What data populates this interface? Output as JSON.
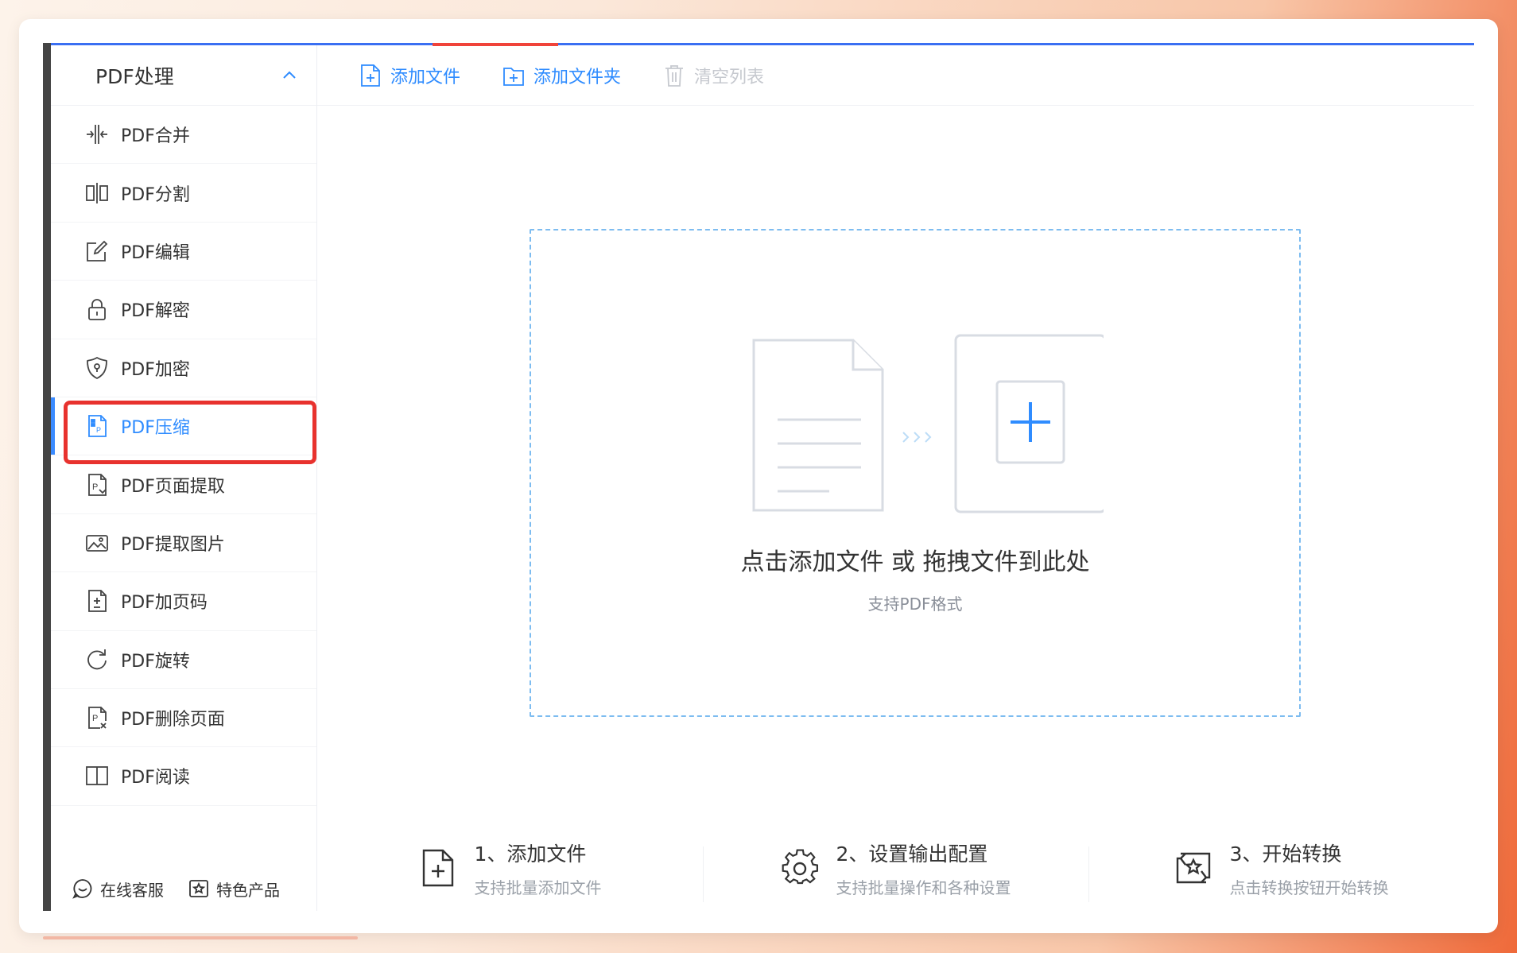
{
  "sidebar": {
    "header_title": "PDF处理",
    "items": [
      {
        "label": "PDF合并",
        "icon": "merge-icon"
      },
      {
        "label": "PDF分割",
        "icon": "split-icon"
      },
      {
        "label": "PDF编辑",
        "icon": "edit-icon"
      },
      {
        "label": "PDF解密",
        "icon": "unlock-icon"
      },
      {
        "label": "PDF加密",
        "icon": "shield-lock-icon"
      },
      {
        "label": "PDF压缩",
        "icon": "compress-icon",
        "active": true
      },
      {
        "label": "PDF页面提取",
        "icon": "page-extract-icon"
      },
      {
        "label": "PDF提取图片",
        "icon": "image-extract-icon"
      },
      {
        "label": "PDF加页码",
        "icon": "page-number-icon"
      },
      {
        "label": "PDF旋转",
        "icon": "rotate-icon"
      },
      {
        "label": "PDF删除页面",
        "icon": "delete-page-icon"
      },
      {
        "label": "PDF阅读",
        "icon": "book-icon"
      }
    ],
    "footer": {
      "support_label": "在线客服",
      "featured_label": "特色产品"
    }
  },
  "toolbar": {
    "add_file_label": "添加文件",
    "add_folder_label": "添加文件夹",
    "clear_list_label": "清空列表"
  },
  "dropzone": {
    "main_text": "点击添加文件 或 拖拽文件到此处",
    "sub_text": "支持PDF格式"
  },
  "steps": [
    {
      "title": "1、添加文件",
      "desc": "支持批量添加文件",
      "icon": "add-file-icon"
    },
    {
      "title": "2、设置输出配置",
      "desc": "支持批量操作和各种设置",
      "icon": "gear-icon"
    },
    {
      "title": "3、开始转换",
      "desc": "点击转换按钮开始转换",
      "icon": "convert-icon"
    }
  ],
  "colors": {
    "accent": "#2f8cff",
    "highlight": "#e8322e",
    "top_line": "#3a6ff2"
  }
}
